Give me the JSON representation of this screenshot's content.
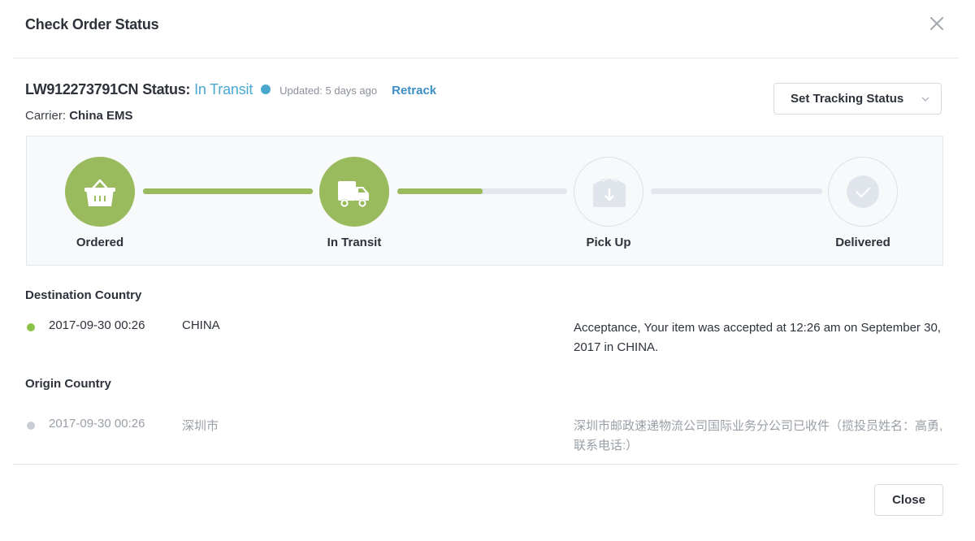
{
  "modal": {
    "title": "Check Order Status",
    "close_icon": "close-x-icon"
  },
  "tracking": {
    "number": "LW912273791CN",
    "status_label": "Status:",
    "status_value": "In Transit",
    "status_color": "#4aa8cf",
    "updated": "Updated: 5 days ago",
    "retrack_label": "Retrack",
    "carrier_label": "Carrier:",
    "carrier_value": "China EMS"
  },
  "set_status_button": {
    "label": "Set Tracking Status",
    "icon": "chevron-down-icon"
  },
  "progress": {
    "accent_color": "#9aba5e",
    "steps": [
      {
        "label": "Ordered",
        "icon": "basket-icon",
        "completed": true
      },
      {
        "label": "In Transit",
        "icon": "truck-icon",
        "completed": true
      },
      {
        "label": "Pick Up",
        "icon": "package-down-icon",
        "completed": false
      },
      {
        "label": "Delivered",
        "icon": "check-circle-icon",
        "completed": false
      }
    ],
    "connectors_fill": [
      1.0,
      0.5,
      0.0
    ]
  },
  "sections": [
    {
      "title": "Destination Country",
      "events": [
        {
          "datetime": "2017-09-30 00:26",
          "location": "CHINA",
          "description": "Acceptance, Your item was accepted at 12:26 am on September 30, 2017 in CHINA.",
          "dot_color": "#8bc34a"
        }
      ]
    },
    {
      "title": "Origin Country",
      "events": [
        {
          "datetime": "2017-09-30 00:26",
          "location": "深圳市",
          "description": "深圳市邮政速递物流公司国际业务分公司已收件（揽投员姓名：高勇,联系电话:）",
          "dot_color": "#c8cdd3"
        }
      ]
    }
  ],
  "footer": {
    "close_label": "Close"
  }
}
